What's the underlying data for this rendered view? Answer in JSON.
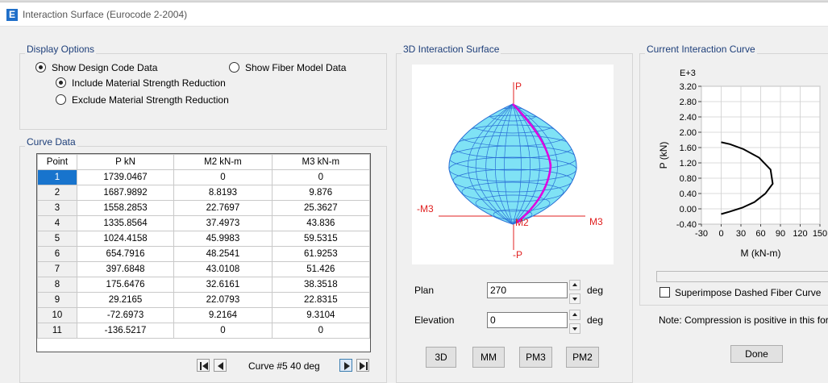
{
  "window": {
    "title": "Interaction Surface (Eurocode 2-2004)",
    "app_icon_letter": "E"
  },
  "display_options": {
    "title": "Display Options",
    "show_design_code": "Show Design Code Data",
    "show_fiber_model": "Show Fiber Model Data",
    "include_reduction": "Include Material Strength Reduction",
    "exclude_reduction": "Exclude Material Strength Reduction"
  },
  "curve_data": {
    "title": "Curve Data",
    "columns": [
      "Point",
      "P  kN",
      "M2  kN-m",
      "M3  kN-m"
    ],
    "rows": [
      [
        "1",
        "1739.0467",
        "0",
        "0"
      ],
      [
        "2",
        "1687.9892",
        "8.8193",
        "9.876"
      ],
      [
        "3",
        "1558.2853",
        "22.7697",
        "25.3627"
      ],
      [
        "4",
        "1335.8564",
        "37.4973",
        "43.836"
      ],
      [
        "5",
        "1024.4158",
        "45.9983",
        "59.5315"
      ],
      [
        "6",
        "654.7916",
        "48.2541",
        "61.9253"
      ],
      [
        "7",
        "397.6848",
        "43.0108",
        "51.426"
      ],
      [
        "8",
        "175.6476",
        "32.6161",
        "38.3518"
      ],
      [
        "9",
        "29.2165",
        "22.0793",
        "22.8315"
      ],
      [
        "10",
        "-72.6973",
        "9.2164",
        "9.3104"
      ],
      [
        "11",
        "-136.5217",
        "0",
        "0"
      ]
    ],
    "nav_label": "Curve #5  40 deg"
  },
  "surface3d": {
    "title": "3D Interaction Surface",
    "label_p": "P",
    "label_neg_p": "-P",
    "label_m3": "M3",
    "label_neg_m3": "-M3",
    "label_m2": "M2",
    "plan_label": "Plan",
    "plan_value": "270",
    "plan_unit": "deg",
    "elev_label": "Elevation",
    "elev_value": "0",
    "elev_unit": "deg",
    "buttons": [
      "3D",
      "MM",
      "PM3",
      "PM2"
    ],
    "colors": {
      "surface": "#7fe2f5",
      "mesh": "#2a6fd6",
      "curve": "#e000e0",
      "axes": "#e02020"
    }
  },
  "current_curve": {
    "title": "Current Interaction Curve",
    "superimpose_label": "Superimpose Dashed Fiber Curve",
    "note": "Note:  Compression is positive in this form.",
    "done_label": "Done"
  },
  "chart_data": {
    "type": "line",
    "ylabel": "P (kN)",
    "xlabel": "M (kN-m)",
    "y_multiplier_label": "E+3",
    "xlim": [
      -30,
      150
    ],
    "ylim": [
      -0.4,
      3.2
    ],
    "x_ticks": [
      "-30",
      "0",
      "30",
      "60",
      "90",
      "120",
      "150"
    ],
    "y_ticks": [
      "3.20",
      "2.80",
      "2.40",
      "2.00",
      "1.60",
      "1.20",
      "0.80",
      "0.40",
      "0.00",
      "-0.40"
    ],
    "x_tick_values": [
      -30,
      0,
      30,
      60,
      90,
      120,
      150
    ],
    "y_tick_values": [
      3.2,
      2.8,
      2.4,
      2.0,
      1.6,
      1.2,
      0.8,
      0.4,
      0.0,
      -0.4
    ],
    "series": [
      {
        "x": [
          0,
          13.3,
          33.9,
          57.6,
          75.0,
          78.3,
          67.1,
          50.5,
          31.9,
          13.1,
          0
        ],
        "y": [
          1.739,
          1.688,
          1.558,
          1.336,
          1.024,
          0.655,
          0.398,
          0.176,
          0.029,
          -0.073,
          -0.137
        ]
      }
    ]
  }
}
